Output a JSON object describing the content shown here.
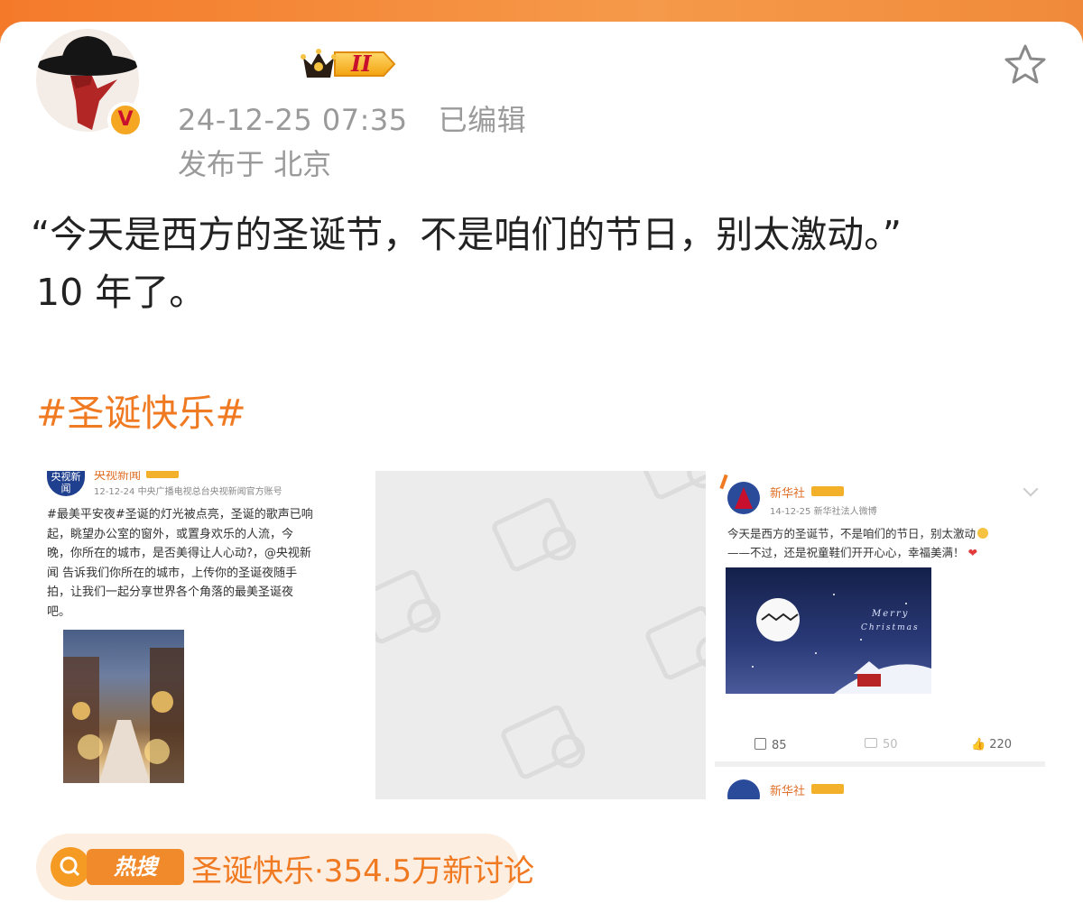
{
  "post": {
    "username": "",
    "level_badge": "II",
    "timestamp": "24-12-25 07:35",
    "edited_label": "已编辑",
    "location": "发布于 北京",
    "verified_mark": "V",
    "content_line1": "“今天是西方的圣诞节，不是咱们的节日，别太激动。”",
    "content_line2": "10 年了。",
    "hashtag": "#圣诞快乐#"
  },
  "images": [
    {
      "account": "央视新闻",
      "account_logo": "央视新闻",
      "date_line": "12-12-24  中央广播电视总台央视新闻官方账号",
      "text_lines": [
        "#最美平安夜#圣诞的灯光被点亮，圣诞的歌声已响",
        "起，眺望办公室的窗外，或置身欢乐的人流，今",
        "晚，你所在的城市，是否美得让人心动?，@央视新",
        "闻 告诉我们你所在的城市，上传你的圣诞夜随手",
        "拍，让我们一起分享世界各个角落的最美圣诞夜",
        "吧。"
      ]
    },
    {
      "placeholder": "image-loading-placeholder"
    },
    {
      "account": "新华社",
      "date_line": "14-12-25  新华社法人微博",
      "text_line1": "今天是西方的圣诞节，不是咱们的节日，别太激动",
      "text_line2": "——不过，还是祝童鞋们开开心心，幸福美满！",
      "card_text_1": "Merry",
      "card_text_2": "Christmas",
      "repost_count": "85",
      "comment_count": "50",
      "like_count": "220",
      "second_account": "新华社"
    }
  ],
  "hot_search": {
    "label": "热搜",
    "text": "圣诞快乐·354.5万新讨论"
  },
  "colors": {
    "accent": "#f07a22",
    "link": "#3a6fb7",
    "meta": "#9a9a9a"
  }
}
